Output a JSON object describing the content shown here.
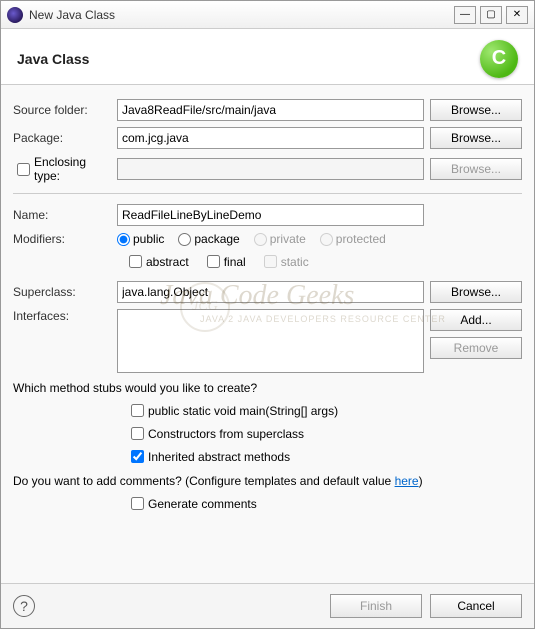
{
  "window": {
    "title": "New Java Class"
  },
  "header": {
    "title": "Java Class",
    "icon_letter": "C"
  },
  "form": {
    "source_folder_label": "Source folder:",
    "source_folder_value": "Java8ReadFile/src/main/java",
    "package_label": "Package:",
    "package_value": "com.jcg.java",
    "enclosing_type_label": "Enclosing type:",
    "enclosing_type_value": "",
    "name_label": "Name:",
    "name_value": "ReadFileLineByLineDemo",
    "modifiers_label": "Modifiers:",
    "superclass_label": "Superclass:",
    "superclass_value": "java.lang.Object",
    "interfaces_label": "Interfaces:"
  },
  "modifiers": {
    "public": "public",
    "package": "package",
    "private": "private",
    "protected": "protected",
    "abstract": "abstract",
    "final": "final",
    "static": "static"
  },
  "buttons": {
    "browse": "Browse...",
    "add": "Add...",
    "remove": "Remove",
    "finish": "Finish",
    "cancel": "Cancel"
  },
  "stubs": {
    "question": "Which method stubs would you like to create?",
    "main": "public static void main(String[] args)",
    "constructors": "Constructors from superclass",
    "inherited": "Inherited abstract methods"
  },
  "comments": {
    "question_prefix": "Do you want to add comments? (Configure templates and default value ",
    "link": "here",
    "question_suffix": ")",
    "generate": "Generate comments"
  },
  "watermark": {
    "main": "Java Code Geeks",
    "sub": "JAVA 2 JAVA DEVELOPERS RESOURCE CENTER",
    "circle": "JCG"
  }
}
